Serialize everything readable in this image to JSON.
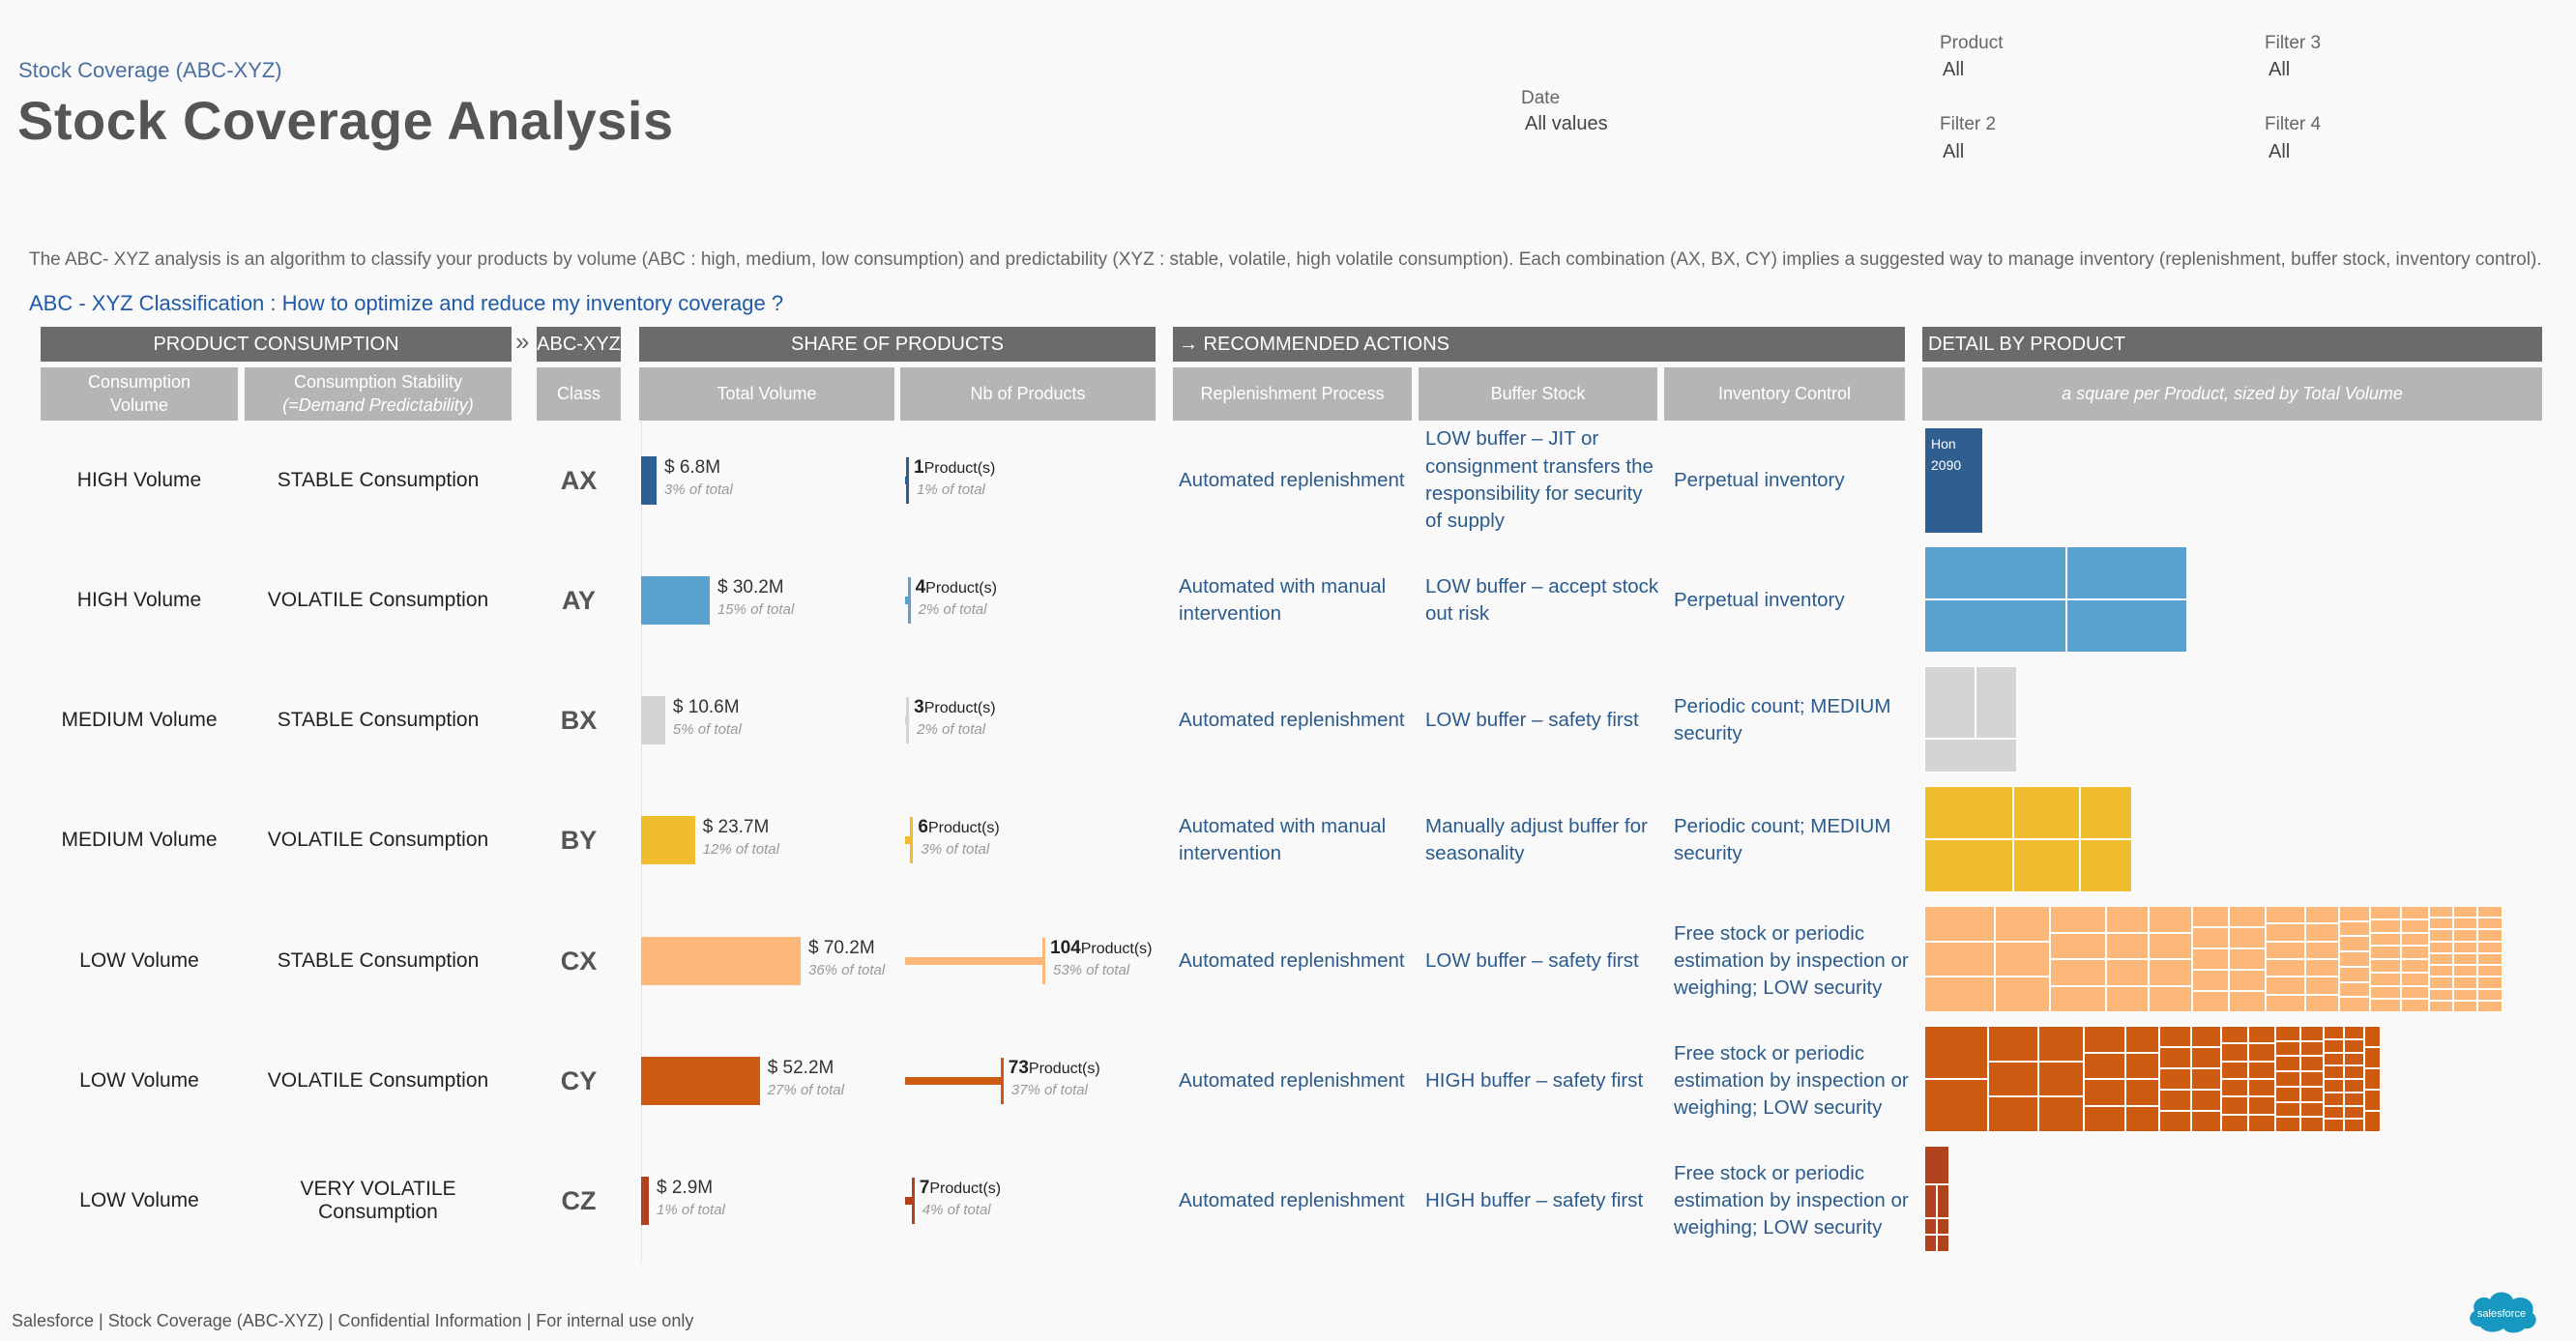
{
  "breadcrumb": "Stock Coverage (ABC-XYZ)",
  "title": "Stock Coverage Analysis",
  "filters": {
    "date": {
      "label": "Date",
      "value": "All values"
    },
    "product": {
      "label": "Product",
      "value": "All"
    },
    "filter2": {
      "label": "Filter 2",
      "value": "All"
    },
    "filter3": {
      "label": "Filter 3",
      "value": "All"
    },
    "filter4": {
      "label": "Filter 4",
      "value": "All"
    }
  },
  "description": "The ABC- XYZ analysis is an algorithm  to classify your products by volume (ABC : high, medium, low consumption)  and predictability (XYZ : stable, volatile, high volatile consumption). Each combination (AX, BX, CY) implies a suggested way to manage inventory (replenishment, buffer stock, inventory control).",
  "subtitle": "ABC - XYZ Classification : How to optimize and reduce my inventory coverage ?",
  "headers": {
    "product_consumption": "PRODUCT CONSUMPTION",
    "separator": "»",
    "abc_xyz": "ABC-XYZ",
    "share_of_products": "SHARE OF PRODUCTS",
    "recommended_actions": "→ RECOMMENDED ACTIONS",
    "detail_by_product": "DETAIL BY PRODUCT"
  },
  "subheaders": {
    "consumption_volume": "Consumption Volume",
    "stability_line1": "Consumption Stability",
    "stability_line2": "(=Demand Predictability)",
    "class": "Class",
    "total_volume": "Total Volume",
    "nb_products": "Nb of Products",
    "replenishment": "Replenishment Process",
    "buffer": "Buffer Stock",
    "inventory": "Inventory Control",
    "detail_note": "a square per Product, sized by Total Volume"
  },
  "product_suffix": "Product(s)",
  "rows": [
    {
      "volume": "HIGH Volume",
      "stability": "STABLE Consumption",
      "cls": "AX",
      "total": "$ 6.8M",
      "total_value": 6.8,
      "total_pct": "3% of total",
      "count": "1",
      "count_value": 1,
      "count_pct": "1% of total",
      "color": "#2f5f91",
      "replenishment": "Automated replenishment",
      "buffer": "LOW buffer – JIT or consignment transfers the responsibility for security of supply",
      "inventory": "Perpetual inventory"
    },
    {
      "volume": "HIGH Volume",
      "stability": "VOLATILE Consumption",
      "cls": "AY",
      "total": "$ 30.2M",
      "total_value": 30.2,
      "total_pct": "15% of total",
      "count": "4",
      "count_value": 4,
      "count_pct": "2% of total",
      "color": "#5ba1cf",
      "replenishment": "Automated with manual intervention",
      "buffer": "LOW buffer – accept stock out risk",
      "inventory": "Perpetual inventory"
    },
    {
      "volume": "MEDIUM Volume",
      "stability": "STABLE Consumption",
      "cls": "BX",
      "total": "$ 10.6M",
      "total_value": 10.6,
      "total_pct": "5% of total",
      "count": "3",
      "count_value": 3,
      "count_pct": "2% of total",
      "color": "#d4d4d4",
      "replenishment": "Automated replenishment",
      "buffer": "LOW buffer – safety first",
      "inventory": "Periodic count; MEDIUM security"
    },
    {
      "volume": "MEDIUM Volume",
      "stability": "VOLATILE Consumption",
      "cls": "BY",
      "total": "$ 23.7M",
      "total_value": 23.7,
      "total_pct": "12% of total",
      "count": "6",
      "count_value": 6,
      "count_pct": "3% of total",
      "color": "#efbd2d",
      "replenishment": "Automated with manual intervention",
      "buffer": "Manually adjust buffer for seasonality",
      "inventory": "Periodic count; MEDIUM security"
    },
    {
      "volume": "LOW Volume",
      "stability": "STABLE Consumption",
      "cls": "CX",
      "total": "$ 70.2M",
      "total_value": 70.2,
      "total_pct": "36% of total",
      "count": "104",
      "count_value": 104,
      "count_pct": "53% of total",
      "color": "#fbb878",
      "replenishment": "Automated replenishment",
      "buffer": "LOW buffer – safety first",
      "inventory": "Free stock or periodic estimation by inspection or weighing; LOW security"
    },
    {
      "volume": "LOW Volume",
      "stability": "VOLATILE Consumption",
      "cls": "CY",
      "total": "$ 52.2M",
      "total_value": 52.2,
      "total_pct": "27% of total",
      "count": "73",
      "count_value": 73,
      "count_pct": "37% of total",
      "color": "#cc5a10",
      "replenishment": "Automated replenishment",
      "buffer": "HIGH buffer – safety first",
      "inventory": "Free stock or periodic estimation by inspection or weighing; LOW security"
    },
    {
      "volume": "LOW Volume",
      "stability": "VERY VOLATILE Consumption",
      "cls": "CZ",
      "total": "$ 2.9M",
      "total_value": 2.9,
      "total_pct": "1% of total",
      "count": "7",
      "count_value": 7,
      "count_pct": "4% of total",
      "color": "#b0421d",
      "replenishment": "Automated replenishment",
      "buffer": "HIGH buffer – safety first",
      "inventory": "Free stock or periodic estimation by inspection or weighing; LOW security"
    }
  ],
  "treemap_label": {
    "line1": "Hon",
    "line2": "2090"
  },
  "footer": "Salesforce | Stock Coverage (ABC-XYZ) | Confidential Information | For internal use only",
  "logo_text": "salesforce"
}
